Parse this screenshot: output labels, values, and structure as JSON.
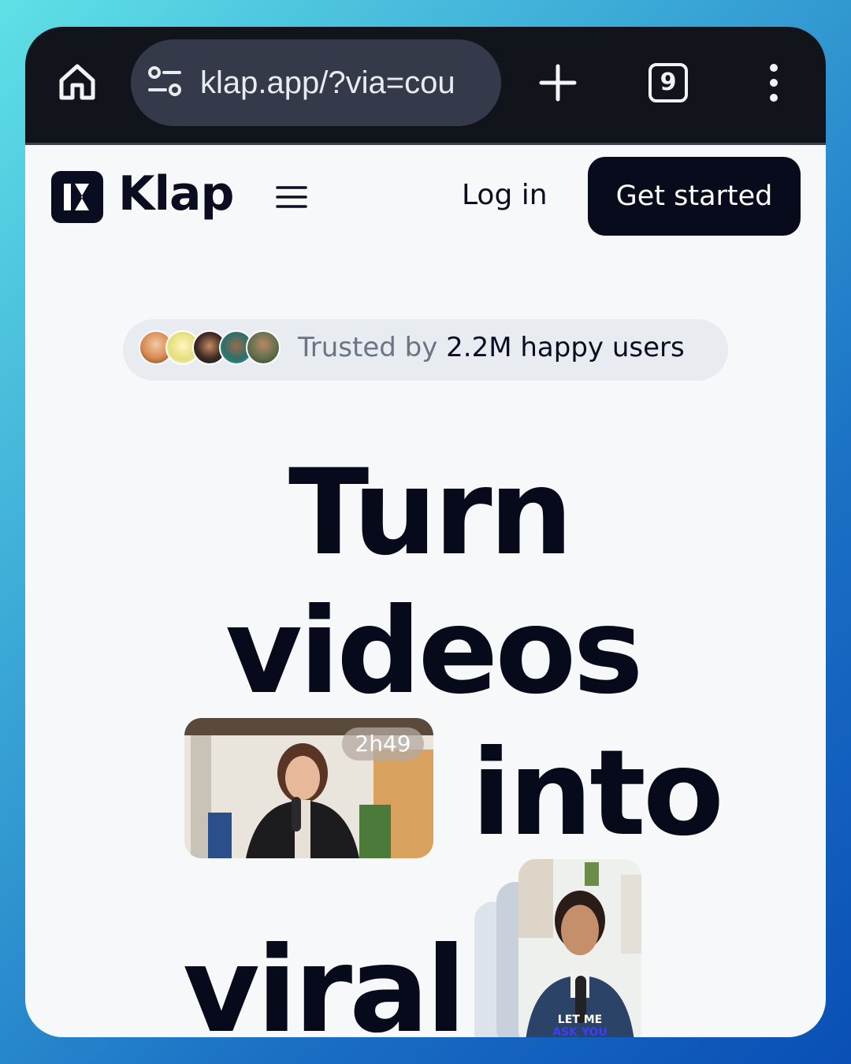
{
  "browser": {
    "url": "klap.app/?via=cou",
    "tab_count": "9",
    "icons": [
      "home-icon",
      "site-settings-icon",
      "plus-icon",
      "tabs-icon",
      "more-vert-icon"
    ]
  },
  "header": {
    "brand": "Klap",
    "login_label": "Log in",
    "cta_label": "Get started"
  },
  "trust": {
    "prefix": "Trusted by ",
    "emphasis": "2.2M happy users",
    "avatar_count": 5
  },
  "hero": {
    "words": [
      "Turn",
      "videos",
      "into",
      "viral"
    ]
  },
  "media": {
    "long_video_duration": "2h49",
    "short_clip_caption_line1": "LET ME",
    "short_clip_caption_line2": "ASK YOU"
  },
  "colors": {
    "browser_bar": "#12141c",
    "url_pill": "#353a4a",
    "brand_dark": "#0a0d1f",
    "page_bg": "#f6f8fa",
    "badge_bg": "#e8ecf1"
  }
}
